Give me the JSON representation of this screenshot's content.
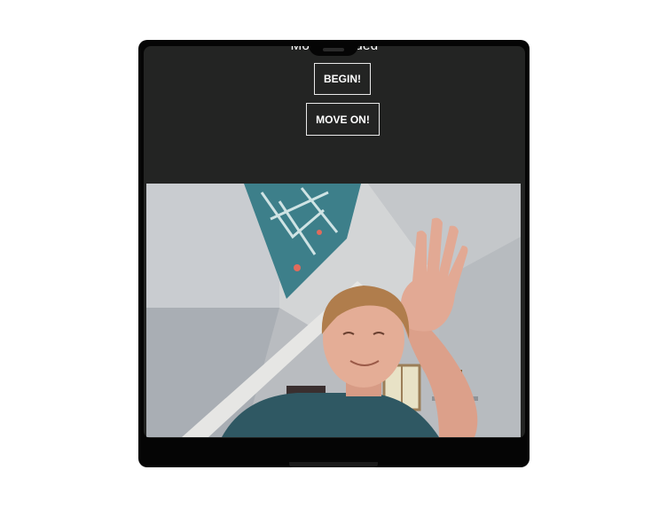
{
  "status": {
    "message": "Model Loaded"
  },
  "buttons": {
    "begin_label": "BEGIN!",
    "move_on_label": "MOVE ON!"
  },
  "colors": {
    "screen_background": "#232423",
    "device_frame": "#050505",
    "button_border": "#e8e8e8",
    "text": "#ffffff"
  },
  "video": {
    "icon": "webcam-feed",
    "description_visible": false
  }
}
